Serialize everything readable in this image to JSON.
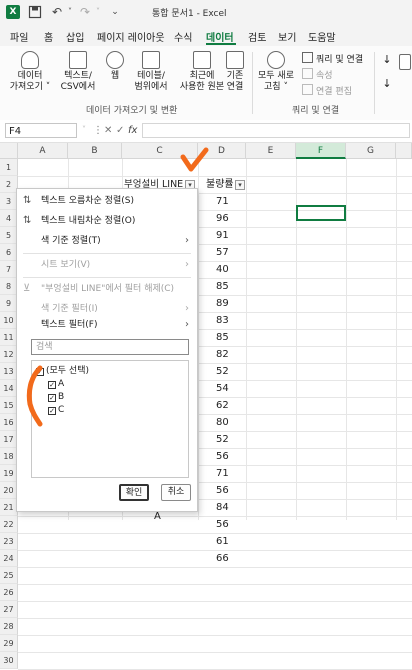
{
  "titlebar": {
    "title": "통합 문서1 - Excel",
    "icons": [
      "excel-logo-icon",
      "save-icon",
      "undo-icon",
      "undo-dropdown-icon",
      "redo-icon",
      "redo-dropdown-icon",
      "customize-qat-icon"
    ]
  },
  "menu": {
    "tabs": [
      "파일",
      "홈",
      "삽입",
      "페이지 레이아웃",
      "수식",
      "데이터",
      "검토",
      "보기",
      "도움말"
    ],
    "active": "데이터"
  },
  "ribbon": {
    "get_data": [
      "데이터",
      "가져오기 ˅"
    ],
    "text_csv": [
      "텍스트/",
      "CSV에서"
    ],
    "web": "웹",
    "table_range": [
      "테이블/",
      "범위에서"
    ],
    "recent_sources": [
      "최근에",
      "사용한 원본"
    ],
    "existing_conn": [
      "기존",
      "연결"
    ],
    "refresh_all": [
      "모두 새로",
      "고침 ˅"
    ],
    "queries_conn": "쿼리 및 연결",
    "properties": "속성",
    "edit_links": "연결 편집",
    "group_get_transform": "데이터 가져오기 및 변환",
    "group_queries": "쿼리 및 연결"
  },
  "formula": {
    "namebox": "F4",
    "cancel_symbol": "✕",
    "enter_symbol": "✓",
    "fx": "fx",
    "value": ""
  },
  "grid": {
    "columns": [
      "A",
      "B",
      "C",
      "D",
      "E",
      "F",
      "G"
    ],
    "selected_column": "F",
    "rows": [
      "1",
      "2",
      "3",
      "4",
      "5",
      "6",
      "7",
      "8",
      "9",
      "10",
      "11",
      "12",
      "13",
      "14",
      "15",
      "16",
      "17",
      "18",
      "19",
      "20",
      "21",
      "22",
      "23",
      "24",
      "25",
      "26",
      "27",
      "28",
      "29",
      "30"
    ],
    "header_c": "부엉설비 LINE",
    "header_d": "불량률",
    "d_values": [
      "71",
      "96",
      "91",
      "57",
      "40",
      "85",
      "89",
      "83",
      "85",
      "82",
      "52",
      "54",
      "62",
      "80",
      "52",
      "56",
      "71",
      "56",
      "84",
      "56",
      "61",
      "66"
    ],
    "c_bottom": "A"
  },
  "filter_menu": {
    "sort_asc": "텍스트 오름차순 정렬(S)",
    "sort_desc": "텍스트 내림차순 정렬(O)",
    "sort_color": "색 기준 정렬(T)",
    "sheet_view": "시트 보기(V)",
    "clear_filter": "\"부엉설비 LINE\"에서 필터 해제(C)",
    "filter_color": "색 기준 필터(I)",
    "text_filter": "텍스트 필터(F)",
    "search_placeholder": "검색",
    "items": [
      "(모두 선택)",
      "A",
      "B",
      "C"
    ],
    "ok": "확인",
    "cancel": "취소"
  },
  "colors": {
    "accent": "#107c41",
    "annotation": "#f26a1b"
  }
}
